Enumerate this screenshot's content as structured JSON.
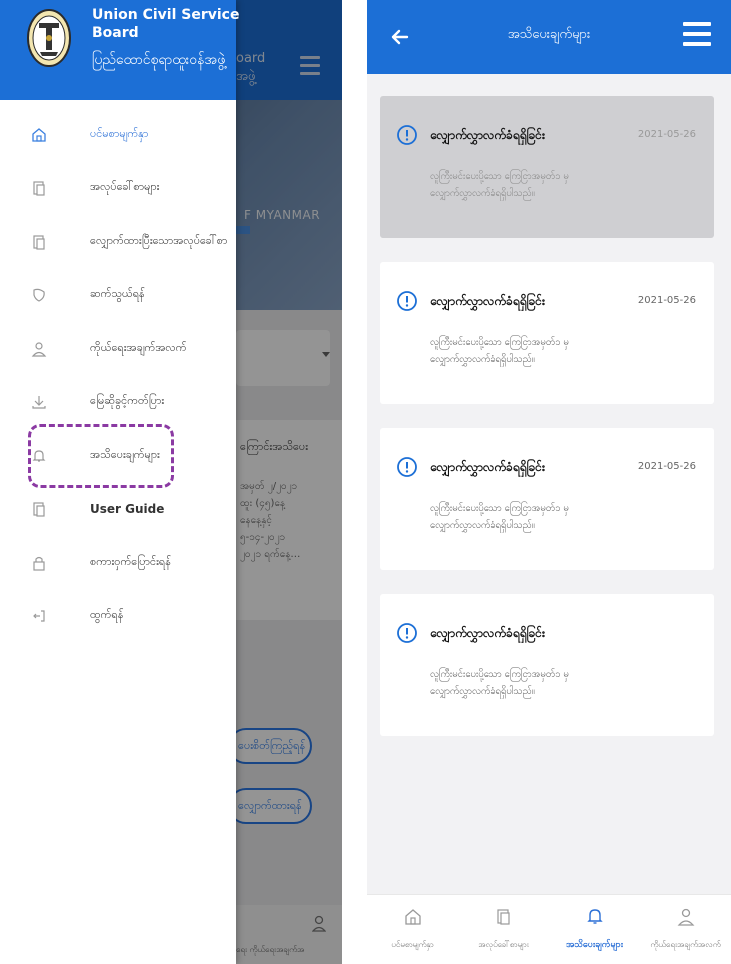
{
  "left": {
    "background_app": {
      "header_title_fragment": "oard\nအဖွဲ့",
      "banner_text": "F MYANMAR",
      "card_title": "ကြောင်းအသိပေး",
      "card_text": "အမှတ် ၂/၂၀၂၁\nထူး (၄၅)နေ့\nနေနေ့နှင့်\n၅-၁၄-၂၀၂၁\n၂၀၂၁ ရက်နေ့…",
      "pill_1": "ပေးစိတ်ကြည့်ရန်",
      "pill_2": "လျှောက်ထားရန်",
      "bottom_text": "ရေး ကိုယ်ရေးအချက်အ"
    },
    "drawer": {
      "title": "Union Civil Service\nBoard",
      "subtitle": "ပြည်ထောင်စုရာထူးဝန်အဖွဲ့",
      "menu": [
        {
          "label": "ပင်မစာမျက်နှာ",
          "icon": "home-icon",
          "active": true
        },
        {
          "label": "အလုပ်ခေါ်စာများ",
          "icon": "documents-icon"
        },
        {
          "label": "လျှောက်ထားပြီးသောအလုပ်ခေါ်စာ",
          "icon": "applied-documents-icon"
        },
        {
          "label": "ဆက်သွယ်ရန်",
          "icon": "contact-icon"
        },
        {
          "label": "ကိုယ်ရေးအချက်အလက်",
          "icon": "profile-icon"
        },
        {
          "label": "မြေဆိုခွင့်ကတ်ပြား",
          "icon": "download-icon"
        },
        {
          "label": "အသိပေးချက်များ",
          "icon": "bell-icon"
        },
        {
          "label": "User Guide",
          "icon": "guide-icon",
          "bold": true
        },
        {
          "label": "စကားဝှက်ပြောင်းရန်",
          "icon": "lock-icon"
        },
        {
          "label": "ထွက်ရန်",
          "icon": "logout-icon"
        }
      ]
    }
  },
  "right": {
    "header": {
      "title": "အသိပေးချက်များ"
    },
    "notifications": [
      {
        "title": "လျှောက်လွှာလက်ခံရရှိခြင်း",
        "date": "2021-05-26",
        "body_line1": "လူကြီးမင်းပေးပို့သော ကြေငြာအမှတ်၁ မှ",
        "body_line2": "လျှောက်လွှာလက်ခံရရှိပါသည်။"
      },
      {
        "title": "လျှောက်လွှာလက်ခံရရှိခြင်း",
        "date": "2021-05-26",
        "body_line1": "လူကြီးမင်းပေးပို့သော ကြေငြာအမှတ်၁ မှ",
        "body_line2": "လျှောက်လွှာလက်ခံရရှိပါသည်။"
      },
      {
        "title": "လျှောက်လွှာလက်ခံရရှိခြင်း",
        "date": "2021-05-26",
        "body_line1": "လူကြီးမင်းပေးပို့သော ကြေငြာအမှတ်၁ မှ",
        "body_line2": "လျှောက်လွှာလက်ခံရရှိပါသည်။"
      },
      {
        "title": "လျှောက်လွှာလက်ခံရရှိခြင်း",
        "date": "",
        "body_line1": "လူကြီးမင်းပေးပို့သော ကြေငြာအမှတ်၁ မှ",
        "body_line2": "လျှောက်လွှာလက်ခံရရှိပါသည်။"
      }
    ],
    "bottom_nav": [
      {
        "label": "ပင်မစာမျက်နှာ",
        "icon": "home-icon"
      },
      {
        "label": "အလုပ်ခေါ်စာများ",
        "icon": "documents-icon"
      },
      {
        "label": "အသိပေးချက်များ",
        "icon": "bell-icon",
        "active": true
      },
      {
        "label": "ကိုယ်ရေးအချက်အလက်",
        "icon": "profile-icon"
      }
    ]
  },
  "colors": {
    "primary_blue": "#1c6fd6",
    "active_blue": "#2a6fd6",
    "highlight_gray": "#cfcfd2",
    "dashed_purple": "#8b3aa3"
  }
}
